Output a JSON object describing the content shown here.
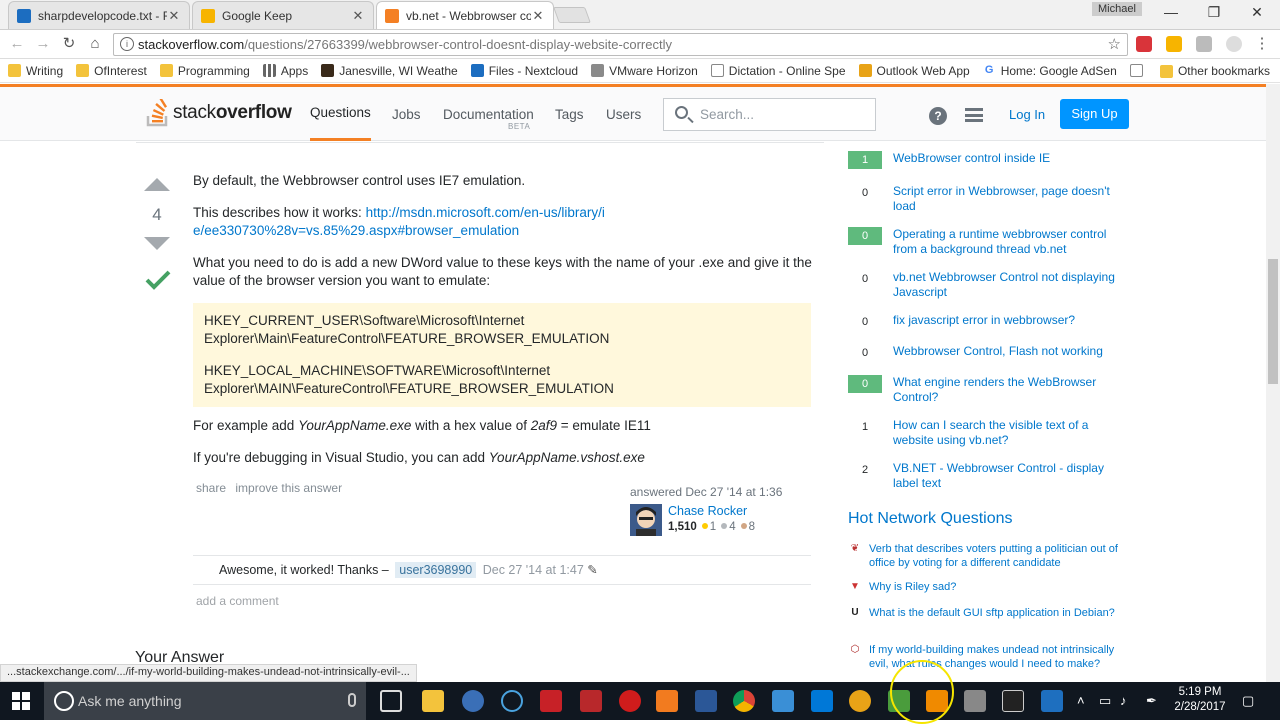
{
  "browser": {
    "tabs": [
      {
        "title": "sharpdevelopcode.txt - F",
        "icon": "nextcloud-icon",
        "color": "#1c6dc0",
        "active": false
      },
      {
        "title": "Google Keep",
        "icon": "keep-icon",
        "color": "#f7b400",
        "active": false
      },
      {
        "title": "vb.net - Webbrowser cor",
        "icon": "stackoverflow-icon",
        "color": "#f48024",
        "active": true
      }
    ],
    "user": "Michael",
    "url_host": "stackoverflow.com",
    "url_path": "/questions/27663399/webbrowser-control-doesnt-display-website-correctly",
    "bookmarks": [
      {
        "label": "Writing",
        "icon": "folder-icon"
      },
      {
        "label": "OfInterest",
        "icon": "folder-icon"
      },
      {
        "label": "Programming",
        "icon": "folder-icon"
      },
      {
        "label": "Apps",
        "icon": "apps-icon"
      },
      {
        "label": "Janesville, WI Weathe",
        "icon": "weather-icon"
      },
      {
        "label": "Files - Nextcloud",
        "icon": "nextcloud-icon"
      },
      {
        "label": "VMware Horizon",
        "icon": "vmware-icon"
      },
      {
        "label": "Dictation - Online Spe",
        "icon": "page-icon"
      },
      {
        "label": "Outlook Web App",
        "icon": "outlook-icon"
      },
      {
        "label": "Home: Google AdSen",
        "icon": "google-icon"
      }
    ],
    "bookmarks_more": "»",
    "other_bookmarks": "Other bookmarks",
    "status_url": "...stackexchange.com/.../if-my-world-building-makes-undead-not-intrinsically-evil-..."
  },
  "so": {
    "logo_light": "stack",
    "logo_bold": "overflow",
    "nav": [
      {
        "label": "Questions",
        "active": true
      },
      {
        "label": "Jobs",
        "active": false
      },
      {
        "label": "Documentation",
        "active": false
      },
      {
        "label": "Tags",
        "active": false
      },
      {
        "label": "Users",
        "active": false
      }
    ],
    "beta": "BETA",
    "search_placeholder": "Search...",
    "help": "?",
    "login": "Log In",
    "signup": "Sign Up"
  },
  "answer": {
    "votes": "4",
    "p1": "By default, the Webbrowser control uses IE7 emulation.",
    "p2_text": "This describes how it works: ",
    "p2_link": "http://msdn.microsoft.com/en-us/library/ie/ee330730%28v=vs.85%29.aspx#browser_emulation",
    "p3": "What you need to do is add a new DWord value to these keys with the name of your .exe and give it the value of the browser version you want to emulate:",
    "code1": "HKEY_CURRENT_USER\\Software\\Microsoft\\Internet Explorer\\Main\\FeatureControl\\FEATURE_BROWSER_EMULATION",
    "code2": "HKEY_LOCAL_MACHINE\\SOFTWARE\\Microsoft\\Internet Explorer\\MAIN\\FeatureControl\\FEATURE_BROWSER_EMULATION",
    "p4_a": "For example add ",
    "p4_em1": "YourAppName.exe",
    "p4_b": " with a hex value of ",
    "p4_em2": "2af9",
    "p4_c": " = emulate IE11",
    "p5_a": "If you're debugging in Visual Studio, you can add ",
    "p5_em": "YourAppName.vshost.exe",
    "share": "share",
    "improve": "improve this answer",
    "answered": "answered Dec 27 '14 at 1:36",
    "author": "Chase Rocker",
    "rep": "1,510",
    "gold": "1",
    "silver": "4",
    "bronze": "8",
    "comment_text": "Awesome, it worked! Thanks –",
    "comment_user": "user3698990",
    "comment_date": "Dec 27 '14 at 1:47",
    "add_comment": "add a comment",
    "your_answer": "Your Answer"
  },
  "linked": [
    {
      "score": "1",
      "accepted": true,
      "title": "WebBrowser control inside IE"
    },
    {
      "score": "0",
      "accepted": false,
      "title": "Script error in Webbrowser, page doesn't load"
    },
    {
      "score": "0",
      "accepted": true,
      "title": "Operating a runtime webbrowser control from a background thread vb.net"
    },
    {
      "score": "0",
      "accepted": false,
      "title": "vb.net Webbrowser Control not displaying Javascript"
    },
    {
      "score": "0",
      "accepted": false,
      "title": "fix javascript error in webbrowser?"
    },
    {
      "score": "0",
      "accepted": false,
      "title": "Webbrowser Control, Flash not working"
    },
    {
      "score": "0",
      "accepted": true,
      "title": "What engine renders the WebBrowser Control?"
    },
    {
      "score": "1",
      "accepted": false,
      "title": "How can I search the visible text of a website using vb.net?"
    },
    {
      "score": "2",
      "accepted": false,
      "title": "VB.NET - Webbrowser Control - display label text"
    }
  ],
  "hnq": {
    "title": "Hot Network Questions",
    "items": [
      {
        "title": "Verb that describes voters putting a politician out of office by voting for a different candidate",
        "icon": "english-icon"
      },
      {
        "title": "Why is Riley sad?",
        "icon": "movies-icon"
      },
      {
        "title": "What is the default GUI sftp application in Debian?",
        "icon": "unix-icon"
      },
      {
        "title": "If my world-building makes undead not intrinsically evil, what rules changes would I need to make?",
        "icon": "rpg-icon"
      }
    ]
  },
  "taskbar": {
    "search_placeholder": "Ask me anything",
    "time": "5:19 PM",
    "date": "2/28/2017"
  }
}
